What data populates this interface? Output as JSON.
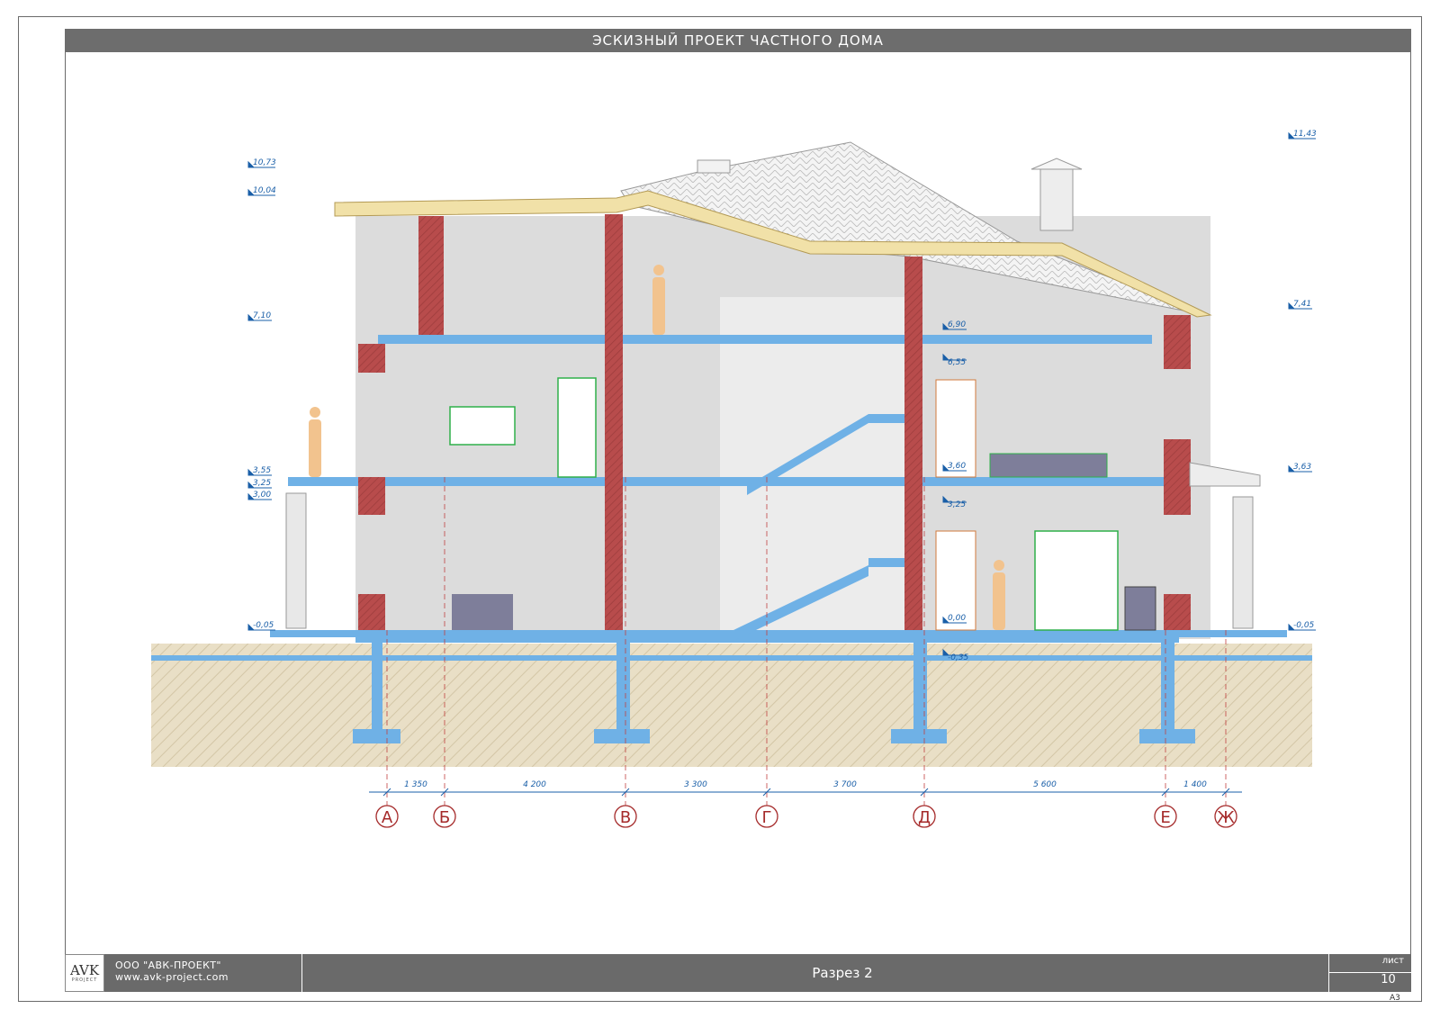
{
  "header": {
    "title": "ЭСКИЗНЫЙ ПРОЕКТ ЧАСТНОГО ДОМА"
  },
  "levels_left": [
    "10,73",
    "10,04",
    "7,10",
    "3,55",
    "3,25",
    "3,00",
    "-0,05"
  ],
  "levels_right": [
    "11,43",
    "7,41",
    "3,63",
    "-0,05"
  ],
  "levels_inner": [
    "6,90",
    "6,55",
    "3,60",
    "3,25",
    "0,00",
    "-0,35"
  ],
  "dimensions": [
    "1 350",
    "4 200",
    "3 300",
    "3 700",
    "5 600",
    "1 400"
  ],
  "axes": [
    "А",
    "Б",
    "В",
    "Г",
    "Д",
    "Е",
    "Ж"
  ],
  "title_block": {
    "logo_text": "AVK",
    "logo_sub": "PROJECT",
    "company": "ООО \"АВК-ПРОЕКТ\"",
    "website": "www.avk-project.com",
    "sheet_name": "Разрез 2",
    "sheet_label": "лист",
    "sheet_number": "10",
    "format": "А3"
  },
  "colors": {
    "slab": "#6fb1e6",
    "wall": "#b84c4c",
    "ground": "#e9dfc6",
    "interior": "#d9d9d9",
    "axis_circle": "#a52a2a",
    "dimension": "#1a5fa8"
  }
}
